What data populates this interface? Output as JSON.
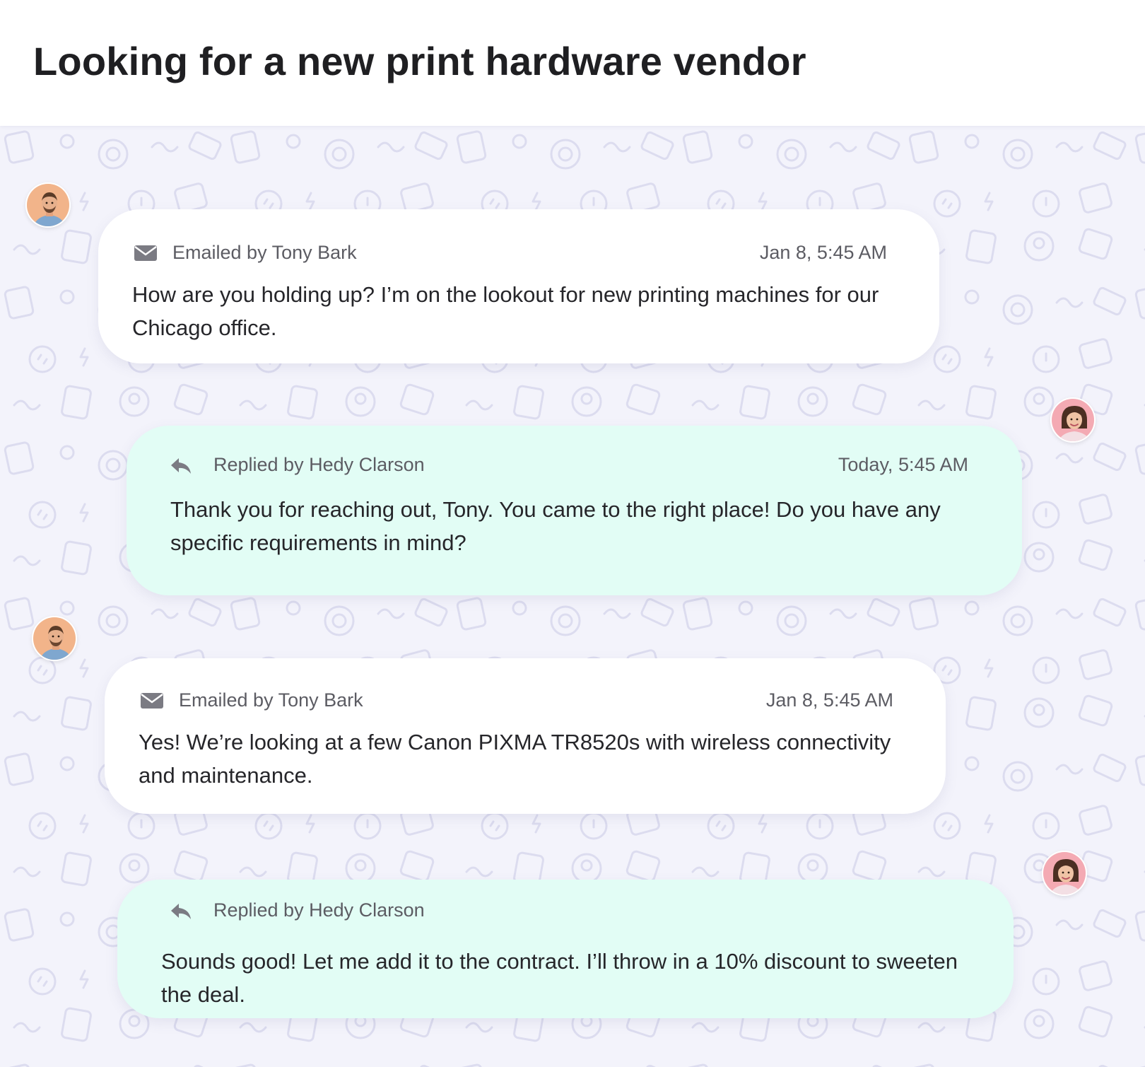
{
  "page": {
    "title": "Looking for a new print hardware vendor"
  },
  "colors": {
    "email_bubble": "#ffffff",
    "reply_bubble": "#e2fdf5",
    "background": "#f3f3fb",
    "meta_text": "#5c5c63",
    "body_text": "#26262a"
  },
  "messages": [
    {
      "type": "email",
      "icon": "envelope-icon",
      "author_line": "Emailed by Tony Bark",
      "timestamp": "Jan 8, 5:45 AM",
      "text": "How are you holding up? I’m on the lookout for new printing machines for our Chicago office.",
      "avatar": "avatar-tony-bark"
    },
    {
      "type": "reply",
      "icon": "reply-arrow-icon",
      "author_line": "Replied by Hedy Clarson",
      "timestamp": "Today, 5:45 AM",
      "text": "Thank you for reaching out, Tony. You came to the right place! Do you have any specific requirements in mind?",
      "avatar": "avatar-hedy-clarson"
    },
    {
      "type": "email",
      "icon": "envelope-icon",
      "author_line": "Emailed by Tony Bark",
      "timestamp": "Jan 8, 5:45 AM",
      "text": "Yes! We’re looking at a few Canon PIXMA TR8520s with wireless connectivity and maintenance.",
      "avatar": "avatar-tony-bark"
    },
    {
      "type": "reply",
      "icon": "reply-arrow-icon",
      "author_line": "Replied by Hedy Clarson",
      "timestamp": "",
      "text": "Sounds good! Let me add it to the contract. I’ll throw in a 10% discount to sweeten the deal.",
      "avatar": "avatar-hedy-clarson"
    }
  ]
}
